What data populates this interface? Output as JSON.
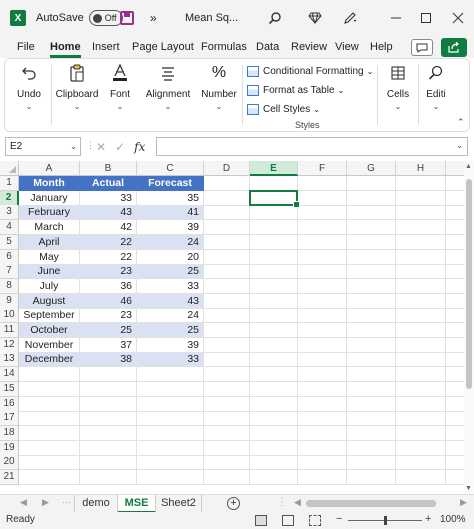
{
  "titlebar": {
    "autosave_label": "AutoSave",
    "autosave_state": "Off",
    "overflow": "»",
    "document_title": "Mean Sq..."
  },
  "menu": {
    "tabs": [
      "File",
      "Home",
      "Insert",
      "Page Layout",
      "Formulas",
      "Data",
      "Review",
      "View",
      "Help"
    ],
    "active": "Home"
  },
  "ribbon": {
    "undo": "Undo",
    "clipboard": "Clipboard",
    "font": "Font",
    "alignment": "Alignment",
    "number": "Number",
    "conditional_formatting": "Conditional Formatting",
    "format_as_table": "Format as Table",
    "cell_styles": "Cell Styles",
    "styles_group": "Styles",
    "cells": "Cells",
    "editing": "Editi"
  },
  "formula_bar": {
    "name_box": "E2",
    "fx": "fx",
    "formula": ""
  },
  "grid": {
    "columns": [
      "A",
      "B",
      "C",
      "D",
      "E",
      "F",
      "G",
      "H"
    ],
    "selected_column": "E",
    "rows": [
      "1",
      "2",
      "3",
      "4",
      "5",
      "6",
      "7",
      "8",
      "9",
      "10",
      "11",
      "12",
      "13",
      "14",
      "15",
      "16",
      "17",
      "18",
      "19",
      "20",
      "21"
    ],
    "selected_row": "2",
    "active_cell": "E2",
    "table_headers": [
      "Month",
      "Actual",
      "Forecast"
    ],
    "table_rows": [
      [
        "January",
        "33",
        "35"
      ],
      [
        "February",
        "43",
        "41"
      ],
      [
        "March",
        "42",
        "39"
      ],
      [
        "April",
        "22",
        "24"
      ],
      [
        "May",
        "22",
        "20"
      ],
      [
        "June",
        "23",
        "25"
      ],
      [
        "July",
        "36",
        "33"
      ],
      [
        "August",
        "46",
        "43"
      ],
      [
        "September",
        "23",
        "24"
      ],
      [
        "October",
        "25",
        "25"
      ],
      [
        "November",
        "37",
        "39"
      ],
      [
        "December",
        "38",
        "33"
      ]
    ],
    "header_color": "#4472c4",
    "band_color": "#d9e1f2",
    "accent_color": "#107c41"
  },
  "sheets": {
    "tabs": [
      "demo",
      "MSE",
      "Sheet2"
    ],
    "active": "MSE",
    "add": "+"
  },
  "status": {
    "ready": "Ready",
    "zoom_minus": "−",
    "zoom_plus": "+",
    "zoom": "100%"
  }
}
